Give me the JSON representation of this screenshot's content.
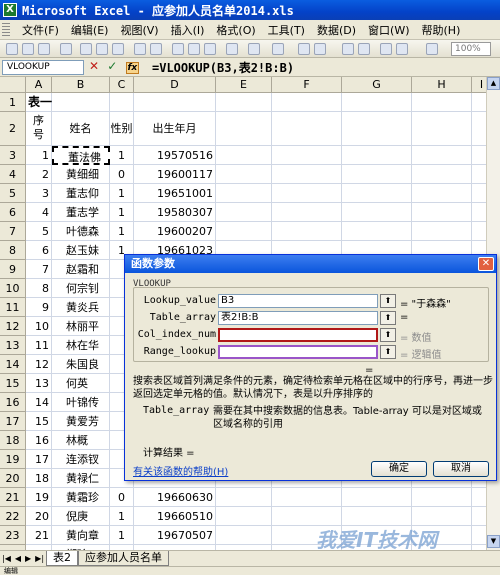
{
  "window": {
    "title": "Microsoft Excel - 应参加人员名单2014.xls",
    "app_icon": "excel-icon"
  },
  "menu": [
    "文件(F)",
    "编辑(E)",
    "视图(V)",
    "插入(I)",
    "格式(O)",
    "工具(T)",
    "数据(D)",
    "窗口(W)",
    "帮助(H)"
  ],
  "toolbar": {
    "zoom": "100%"
  },
  "formula_bar": {
    "name_box": "VLOOKUP",
    "cancel": "✕",
    "enter": "✓",
    "fx": "fx",
    "formula": "=VLOOKUP(B3,表2!B:B)"
  },
  "columns": [
    "A",
    "B",
    "C",
    "D",
    "E",
    "F",
    "G",
    "H",
    "I"
  ],
  "rows": [
    {
      "n": "1",
      "a": "表一",
      "b": "",
      "c": "",
      "d": ""
    },
    {
      "n": "2",
      "a": "序号",
      "b": "姓名",
      "c": "性别",
      "d": "出生年月"
    },
    {
      "n": "3",
      "a": "1",
      "b": "董法佛",
      "c": "1",
      "d": "19570516"
    },
    {
      "n": "4",
      "a": "2",
      "b": "黄细细",
      "c": "0",
      "d": "19600117"
    },
    {
      "n": "5",
      "a": "3",
      "b": "董志仰",
      "c": "1",
      "d": "19651001"
    },
    {
      "n": "6",
      "a": "4",
      "b": "董志学",
      "c": "1",
      "d": "19580307"
    },
    {
      "n": "7",
      "a": "5",
      "b": "叶德森",
      "c": "1",
      "d": "19600207"
    },
    {
      "n": "8",
      "a": "6",
      "b": "赵玉妹",
      "c": "1",
      "d": "19661023"
    },
    {
      "n": "9",
      "a": "7",
      "b": "赵霜和",
      "c": "",
      "d": ""
    },
    {
      "n": "10",
      "a": "8",
      "b": "何宗钊",
      "c": "",
      "d": ""
    },
    {
      "n": "11",
      "a": "9",
      "b": "黄炎兵",
      "c": "",
      "d": ""
    },
    {
      "n": "12",
      "a": "10",
      "b": "林丽平",
      "c": "",
      "d": ""
    },
    {
      "n": "13",
      "a": "11",
      "b": "林在华",
      "c": "",
      "d": ""
    },
    {
      "n": "14",
      "a": "12",
      "b": "朱国良",
      "c": "",
      "d": ""
    },
    {
      "n": "15",
      "a": "13",
      "b": "何英",
      "c": "",
      "d": ""
    },
    {
      "n": "16",
      "a": "14",
      "b": "叶锦传",
      "c": "",
      "d": ""
    },
    {
      "n": "17",
      "a": "15",
      "b": "黄爱芳",
      "c": "",
      "d": ""
    },
    {
      "n": "18",
      "a": "16",
      "b": "林概",
      "c": "",
      "d": ""
    },
    {
      "n": "19",
      "a": "17",
      "b": "连添钗",
      "c": "",
      "d": ""
    },
    {
      "n": "20",
      "a": "18",
      "b": "黄禄仁",
      "c": "",
      "d": ""
    },
    {
      "n": "21",
      "a": "19",
      "b": "黄霜珍",
      "c": "0",
      "d": "19660630"
    },
    {
      "n": "22",
      "a": "20",
      "b": "倪庚",
      "c": "1",
      "d": "19660510"
    },
    {
      "n": "23",
      "a": "21",
      "b": "黄向章",
      "c": "1",
      "d": "19670507"
    },
    {
      "n": "24",
      "a": "22",
      "b": "郑玲",
      "c": "0",
      "d": "19670204"
    }
  ],
  "dialog": {
    "title": "函数参数",
    "close": "✕",
    "function_name": "VLOOKUP",
    "args": [
      {
        "label": "Lookup_value",
        "value": "B3",
        "result": "= \"于森森\"",
        "result_grey": false
      },
      {
        "label": "Table_array",
        "value": "表2!B:B",
        "result": "=",
        "result_grey": false
      },
      {
        "label": "Col_index_num",
        "value": "",
        "result": "= 数值",
        "result_grey": true
      },
      {
        "label": "Range_lookup",
        "value": "",
        "result": "= 逻辑值",
        "result_grey": true
      }
    ],
    "ref_button": "⬆",
    "result_line": "=",
    "description": "搜索表区域首列满足条件的元素，确定待检索单元格在区域中的行序号，再进一步返回选定单元格的值。默认情况下，表是以升序排序的",
    "param_name": "Table_array",
    "param_desc": "需要在其中搜索数据的信息表。Table-array 可以是对区域或区域名称的引用",
    "calc_result": "计算结果 =",
    "help_link": "有关该函数的帮助(H)",
    "ok": "确定",
    "cancel": "取消"
  },
  "sheet_tabs": {
    "active": "表2",
    "other": "应参加人员名单"
  },
  "status": "编辑",
  "watermark": "我爱IT技术网"
}
